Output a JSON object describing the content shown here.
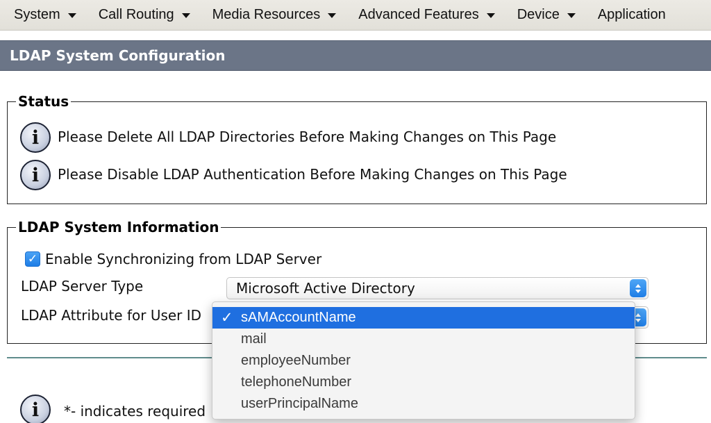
{
  "menu": [
    {
      "label": "System"
    },
    {
      "label": "Call Routing"
    },
    {
      "label": "Media Resources"
    },
    {
      "label": "Advanced Features"
    },
    {
      "label": "Device"
    },
    {
      "label": "Application"
    }
  ],
  "page_title": "LDAP System Configuration",
  "status": {
    "legend": "Status",
    "messages": [
      "Please Delete All LDAP Directories Before Making Changes on This Page",
      "Please Disable LDAP Authentication Before Making Changes on This Page"
    ]
  },
  "ldap_info": {
    "legend": "LDAP System Information",
    "enable_sync_label": "Enable Synchronizing from LDAP Server",
    "enable_sync_checked": true,
    "server_type_label": "LDAP Server Type",
    "server_type_value": "Microsoft Active Directory",
    "attribute_label": "LDAP Attribute for User ID"
  },
  "attribute_options": [
    {
      "label": "sAMAccountName",
      "selected": true
    },
    {
      "label": "mail",
      "selected": false
    },
    {
      "label": "employeeNumber",
      "selected": false
    },
    {
      "label": "telephoneNumber",
      "selected": false
    },
    {
      "label": "userPrincipalName",
      "selected": false
    }
  ],
  "footer_note": "*- indicates required",
  "icons": {
    "info": "info-icon",
    "check": "checkmark-icon",
    "caret": "caret-down-icon",
    "stepper": "up-down-arrows-icon"
  },
  "colors": {
    "title_bar": "#6b7587",
    "accent": "#1f6fe0",
    "divider": "#5f8c8c"
  }
}
